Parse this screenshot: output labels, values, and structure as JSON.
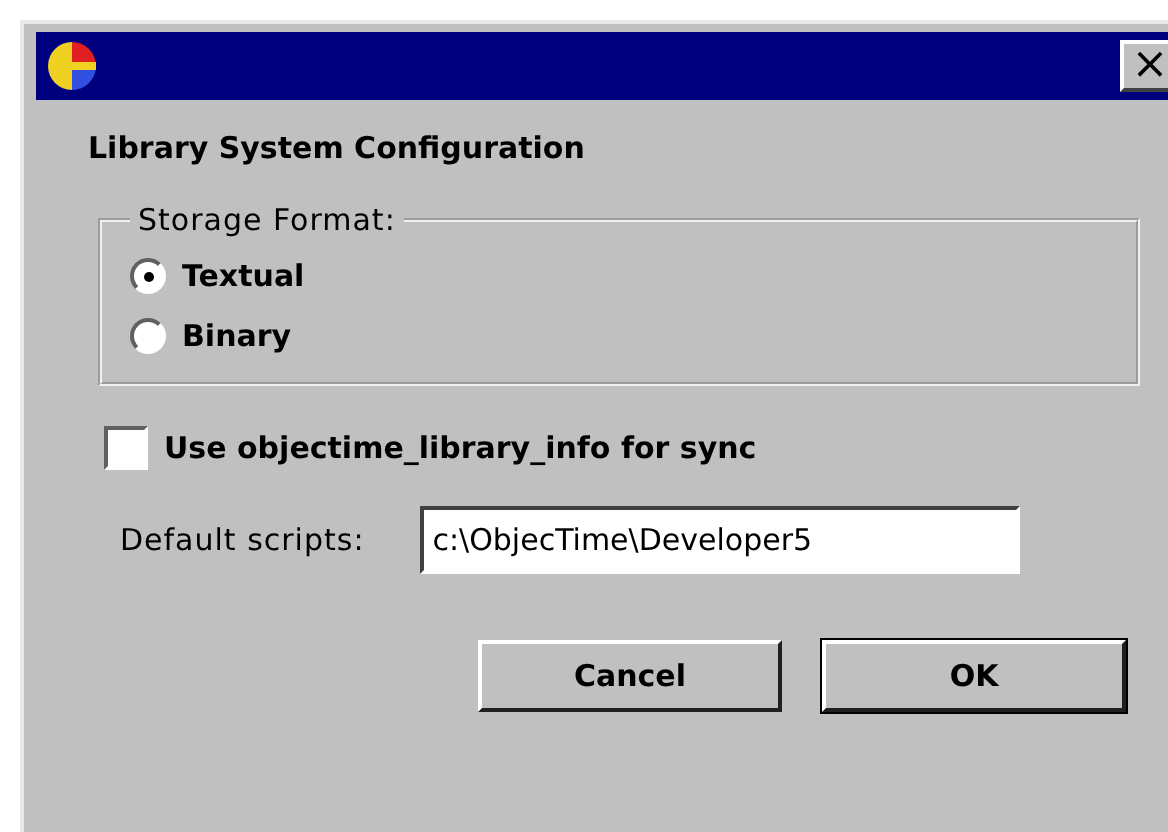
{
  "window": {
    "title_bar": {
      "close": "×"
    },
    "heading": "Library System Configuration"
  },
  "storage_format": {
    "legend": "Storage Format:",
    "options": [
      {
        "label": "Textual",
        "selected": true
      },
      {
        "label": "Binary",
        "selected": false
      }
    ]
  },
  "sync_checkbox": {
    "label": "Use objectime_library_info for sync",
    "checked": false
  },
  "default_scripts": {
    "label": "Default scripts:",
    "value": "c:\\ObjecTime\\Developer5"
  },
  "buttons": [
    {
      "label": "Cancel",
      "default": false
    },
    {
      "label": "OK",
      "default": true
    }
  ]
}
